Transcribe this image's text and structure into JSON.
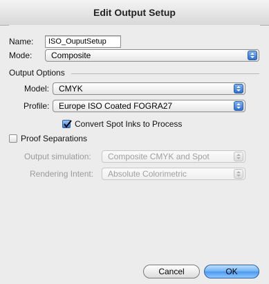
{
  "window": {
    "title": "Edit Output Setup"
  },
  "name_field": {
    "label": "Name:",
    "value": "ISO_OuputSetup"
  },
  "mode": {
    "label": "Mode:",
    "value": "Composite"
  },
  "output_options": {
    "heading": "Output Options",
    "model": {
      "label": "Model:",
      "value": "CMYK"
    },
    "profile": {
      "label": "Profile:",
      "value": "Europe ISO Coated FOGRA27"
    },
    "convert_spot": {
      "label": "Convert Spot Inks to Process",
      "checked": true
    }
  },
  "proof": {
    "label": "Proof Separations",
    "checked": false,
    "simulation": {
      "label": "Output simulation:",
      "value": "Composite CMYK and Spot"
    },
    "intent": {
      "label": "Rendering Intent:",
      "value": "Absolute Colorimetric"
    }
  },
  "buttons": {
    "cancel": "Cancel",
    "ok": "OK"
  },
  "colors": {
    "accent": "#3b7bd6",
    "window_bg": "#ececec"
  }
}
